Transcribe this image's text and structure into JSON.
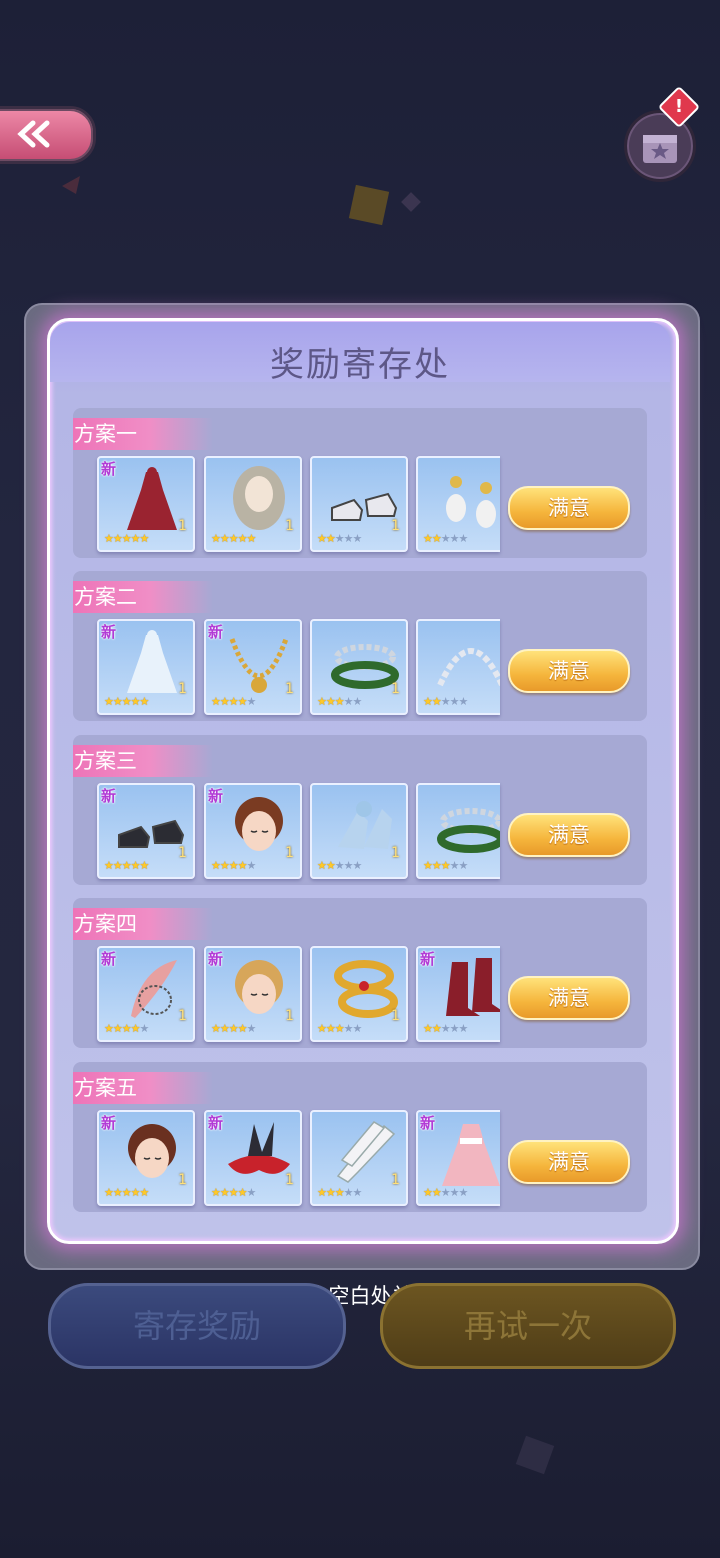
{
  "panel": {
    "title": "奖励寄存处"
  },
  "plans": [
    {
      "label": "方案一",
      "button": "满意",
      "items": [
        {
          "kind": "dress",
          "new": true,
          "stars": 5,
          "max": 5,
          "count": "1",
          "color": "#9a2330"
        },
        {
          "kind": "hair",
          "new": false,
          "stars": 5,
          "max": 5,
          "count": "1",
          "color": "#b9b3a4"
        },
        {
          "kind": "shoes",
          "new": false,
          "stars": 2,
          "max": 5,
          "count": "1",
          "color": "#e8e8ee"
        },
        {
          "kind": "earrings",
          "new": false,
          "stars": 2,
          "max": 5,
          "count": "",
          "color": "#e0b84a"
        }
      ]
    },
    {
      "label": "方案二",
      "button": "满意",
      "items": [
        {
          "kind": "dress",
          "new": true,
          "stars": 5,
          "max": 5,
          "count": "1",
          "color": "#e8f2fb"
        },
        {
          "kind": "necklace",
          "new": true,
          "stars": 4,
          "max": 5,
          "count": "1",
          "color": "#d9a73a"
        },
        {
          "kind": "bracelet",
          "new": false,
          "stars": 3,
          "max": 5,
          "count": "1",
          "color": "#2f6a2c"
        },
        {
          "kind": "headband",
          "new": false,
          "stars": 2,
          "max": 5,
          "count": "",
          "color": "#e4e8f0"
        }
      ]
    },
    {
      "label": "方案三",
      "button": "满意",
      "items": [
        {
          "kind": "shoes",
          "new": true,
          "stars": 5,
          "max": 5,
          "count": "1",
          "color": "#2b2c33"
        },
        {
          "kind": "face",
          "new": true,
          "stars": 4,
          "max": 5,
          "count": "1",
          "color": "#7a3b22"
        },
        {
          "kind": "heels",
          "new": false,
          "stars": 2,
          "max": 5,
          "count": "1",
          "color": "#b7d3ee"
        },
        {
          "kind": "bracelet",
          "new": false,
          "stars": 3,
          "max": 5,
          "count": "",
          "color": "#2f6a2c"
        }
      ]
    },
    {
      "label": "方案四",
      "button": "满意",
      "items": [
        {
          "kind": "feather",
          "new": true,
          "stars": 4,
          "max": 5,
          "count": "1",
          "color": "#e7a0a0"
        },
        {
          "kind": "face",
          "new": true,
          "stars": 4,
          "max": 5,
          "count": "1",
          "color": "#d7a65a"
        },
        {
          "kind": "rings",
          "new": false,
          "stars": 3,
          "max": 5,
          "count": "1",
          "color": "#e1a82e"
        },
        {
          "kind": "boots",
          "new": true,
          "stars": 2,
          "max": 5,
          "count": "",
          "color": "#8a1e2a"
        }
      ]
    },
    {
      "label": "方案五",
      "button": "满意",
      "items": [
        {
          "kind": "face",
          "new": true,
          "stars": 5,
          "max": 5,
          "count": "1",
          "color": "#6a3020"
        },
        {
          "kind": "mask",
          "new": true,
          "stars": 4,
          "max": 5,
          "count": "1",
          "color": "#2c2c35"
        },
        {
          "kind": "gloves",
          "new": false,
          "stars": 3,
          "max": 5,
          "count": "1",
          "color": "#f3f3f6"
        },
        {
          "kind": "gown",
          "new": true,
          "stars": 2,
          "max": 5,
          "count": "",
          "color": "#f2b6c0"
        }
      ]
    }
  ],
  "close_hint": "点击空白处关闭",
  "buttons": {
    "store": "寄存奖励",
    "retry": "再试一次"
  },
  "badges": {
    "alert": "!",
    "new": "新"
  }
}
